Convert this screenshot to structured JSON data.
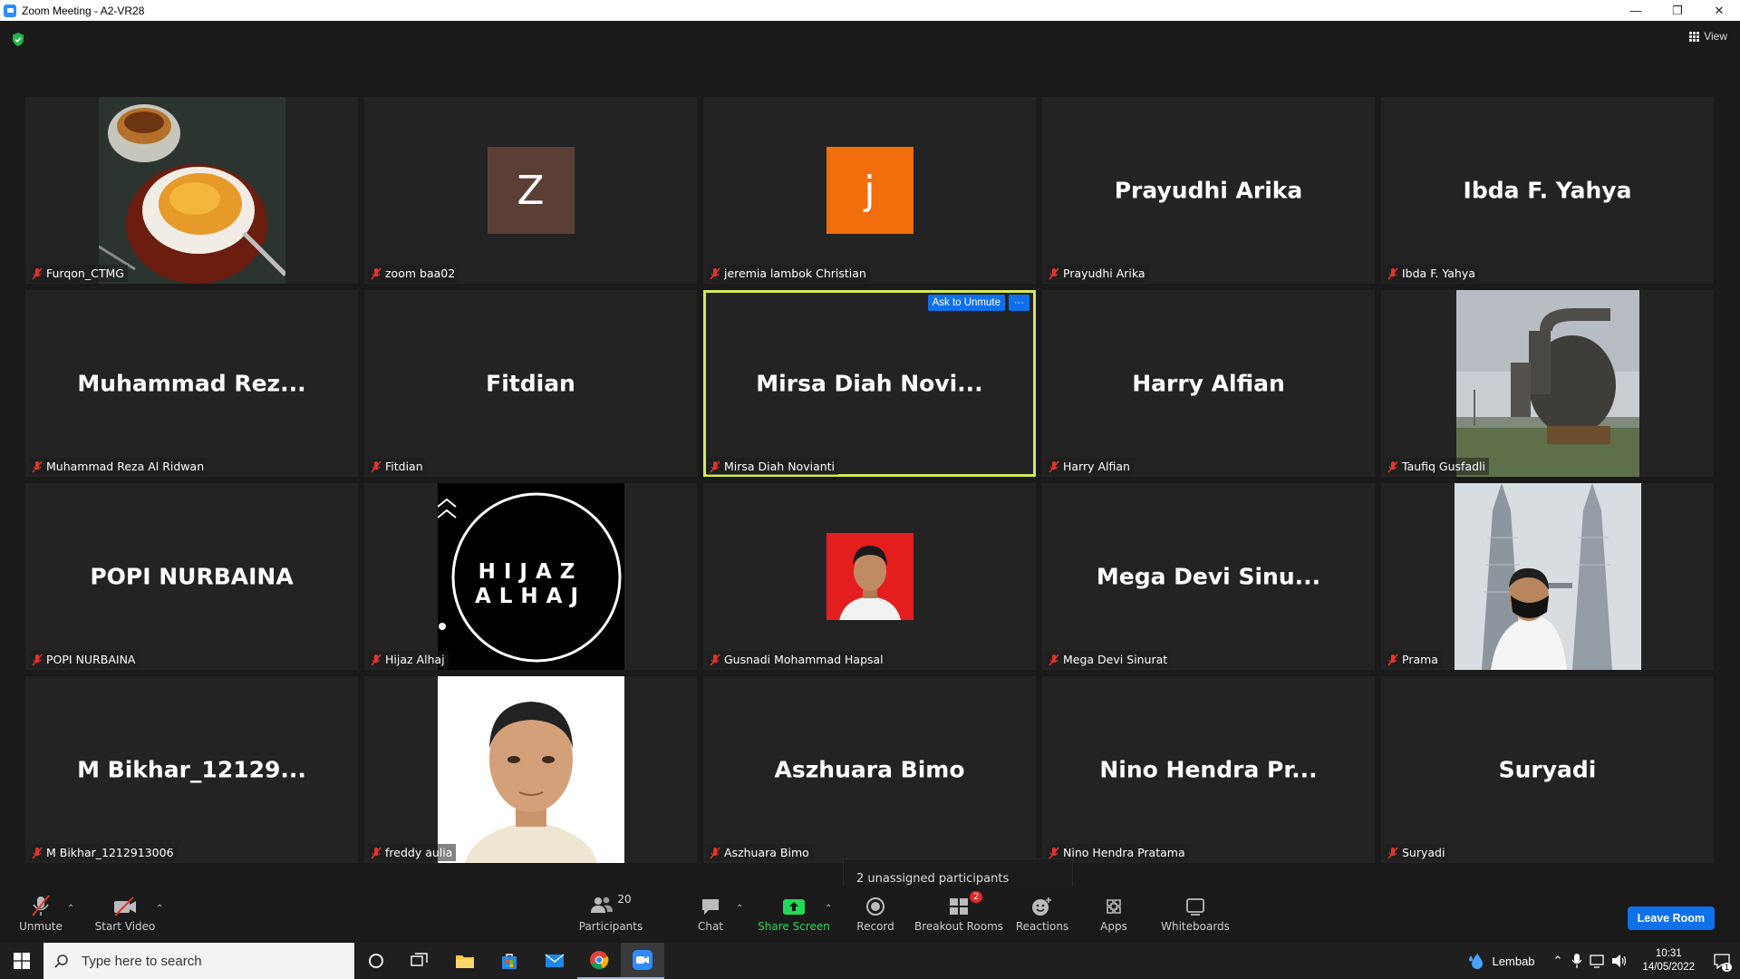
{
  "window": {
    "title": "Zoom Meeting - A2-VR28",
    "minimize": "—",
    "restore": "❐",
    "close": "✕"
  },
  "view_label": "View",
  "tiles": [
    {
      "name": "Furqon_CTMG",
      "big": ""
    },
    {
      "name": "zoom baa02",
      "big": "",
      "initial": "Z",
      "avatar_color": "#5b3f36"
    },
    {
      "name": "jeremia lambok Christian",
      "big": "",
      "initial": "j",
      "avatar_color": "#f26d0b"
    },
    {
      "name": "Prayudhi Arika",
      "big": "Prayudhi Arika"
    },
    {
      "name": "Ibda F. Yahya",
      "big": "Ibda F. Yahya"
    },
    {
      "name": "Muhammad Reza Al Ridwan",
      "big": "Muhammad  Rez..."
    },
    {
      "name": "Fitdian",
      "big": "Fitdian"
    },
    {
      "name": "Mirsa Diah Novianti",
      "big": "Mirsa Diah Novi...",
      "ask": "Ask to Unmute",
      "more": "···"
    },
    {
      "name": "Harry Alfian",
      "big": "Harry Alfian"
    },
    {
      "name": "Taufiq Gusfadli",
      "big": ""
    },
    {
      "name": "POPI NURBAINA",
      "big": "POPI NURBAINA"
    },
    {
      "name": "Hijaz Alhaj",
      "big": "",
      "logo_line1": "HIJAZ",
      "logo_line2": "ALHAJ"
    },
    {
      "name": "Gusnadi Mohammad Hapsal",
      "big": ""
    },
    {
      "name": "Mega Devi Sinurat",
      "big": "Mega Devi Sinu..."
    },
    {
      "name": "Prama",
      "big": ""
    },
    {
      "name": "M Bikhar_1212913006",
      "big": "M  Bikhar_12129..."
    },
    {
      "name": "freddy aulia",
      "big": ""
    },
    {
      "name": "Aszhuara Bimo",
      "big": "Aszhuara Bimo"
    },
    {
      "name": "Nino Hendra Pratama",
      "big": "Nino Hendra Pr..."
    },
    {
      "name": "Suryadi",
      "big": "Suryadi"
    }
  ],
  "tooltip": "2 unassigned participants",
  "toolbar": {
    "unmute": "Unmute",
    "start_video": "Start Video",
    "participants": "Participants",
    "participants_count": "20",
    "chat": "Chat",
    "share_screen": "Share Screen",
    "record": "Record",
    "breakout_rooms": "Breakout Rooms",
    "breakout_badge": "2",
    "reactions": "Reactions",
    "apps": "Apps",
    "whiteboards": "Whiteboards",
    "leave": "Leave Room"
  },
  "taskbar": {
    "search_placeholder": "Type here to search",
    "weather": "Lembab",
    "time": "10:31",
    "date": "14/05/2022",
    "notification_count": "1"
  },
  "colors": {
    "accent": "#0e71eb",
    "active_border": "#d4e85a",
    "share_green": "#23d959",
    "badge_red": "#e02828"
  }
}
